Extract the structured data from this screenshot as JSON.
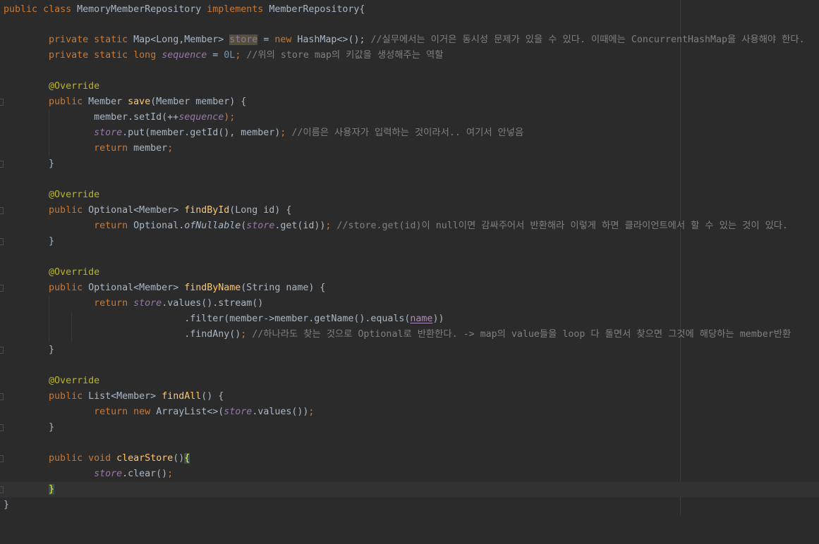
{
  "editor": {
    "lines": {
      "l1": {
        "kw_public": "public",
        "kw_class": "class",
        "class_name": "MemoryMemberRepository",
        "kw_implements": "implements",
        "iface": "MemberRepository{"
      },
      "l3": {
        "kw_private": "private",
        "kw_static": "static",
        "type": "Map<Long,Member>",
        "field": "store",
        "eq": " = ",
        "kw_new": "new",
        "ctor": "HashMap<>();",
        "comment": "//실무에서는 이거은 동시성 문제가 있을 수 있다. 이때에는 ConcurrentHashMap을 사용해야 한다."
      },
      "l4": {
        "kw_private": "private",
        "kw_static": "static",
        "kw_long": "long",
        "field": "sequence",
        "eq": " = ",
        "num": "0L",
        "semi": ";",
        "comment": "//위의 store map의 키값을 생성해주는 역할"
      },
      "l6": {
        "ann": "@Override"
      },
      "l7": {
        "kw_public": "public",
        "type": "Member",
        "fn": "save",
        "params": "(Member member) {"
      },
      "l8": {
        "pre": "member.setId(++",
        "field": "sequence",
        "post": ");"
      },
      "l9": {
        "field": "store",
        "call": ".put(member.getId(), member)",
        "semi": ";",
        "comment": "//이름은 사용자가 입력하는 것이라서.. 여기서 안넣음"
      },
      "l10": {
        "kw_return": "return",
        "rest": "member",
        "semi": ";"
      },
      "l11": {
        "brace": "}"
      },
      "l13": {
        "ann": "@Override"
      },
      "l14": {
        "kw_public": "public",
        "type": "Optional<Member>",
        "fn": "findById",
        "params": "(Long id) {"
      },
      "l15": {
        "kw_return": "return",
        "cls": "Optional.",
        "static_call": "ofNullable",
        "open": "(",
        "field": "store",
        "rest": ".get(id))",
        "semi": ";",
        "comment": "//store.get(id)이 null이면 감싸주어서 반환해라 이렇게 하면 클라이언트에서 할 수 있는 것이 있다."
      },
      "l16": {
        "brace": "}"
      },
      "l18": {
        "ann": "@Override"
      },
      "l19": {
        "kw_public": "public",
        "type": "Optional<Member>",
        "fn": "findByName",
        "params": "(String name) {"
      },
      "l20": {
        "kw_return": "return",
        "field": "store",
        "rest": ".values().stream()"
      },
      "l21": {
        "pre": ".filter(member->member.getName().equals(",
        "ref": "name",
        "post": "))"
      },
      "l22": {
        "pre": ".findAny()",
        "semi": ";",
        "comment": "//하나라도 찾는 것으로 Optional로 반환한다. -> map의 value들을 loop 다 돌면서 찾으면 그것에 해당하는 member반환"
      },
      "l23": {
        "brace": "}"
      },
      "l25": {
        "ann": "@Override"
      },
      "l26": {
        "kw_public": "public",
        "type": "List<Member>",
        "fn": "findAll",
        "params": "() {"
      },
      "l27": {
        "kw_return": "return",
        "kw_new": "new",
        "cls": "ArrayList<>(",
        "field": "store",
        "rest": ".values())",
        "semi": ";"
      },
      "l28": {
        "brace": "}"
      },
      "l30": {
        "kw_public": "public",
        "kw_void": "void",
        "fn": "clearStore",
        "params": "()",
        "brace": "{"
      },
      "l31": {
        "field": "store",
        "rest": ".clear()",
        "semi": ";"
      },
      "l32": {
        "brace": "}"
      },
      "l33": {
        "brace": "}"
      }
    }
  },
  "colors": {
    "background": "#2b2b2b",
    "keyword": "#cc7832",
    "field": "#9876aa",
    "method": "#ffc66d",
    "annotation": "#bbb529",
    "comment": "#808080",
    "number": "#6897bb",
    "text": "#a9b7c6"
  }
}
